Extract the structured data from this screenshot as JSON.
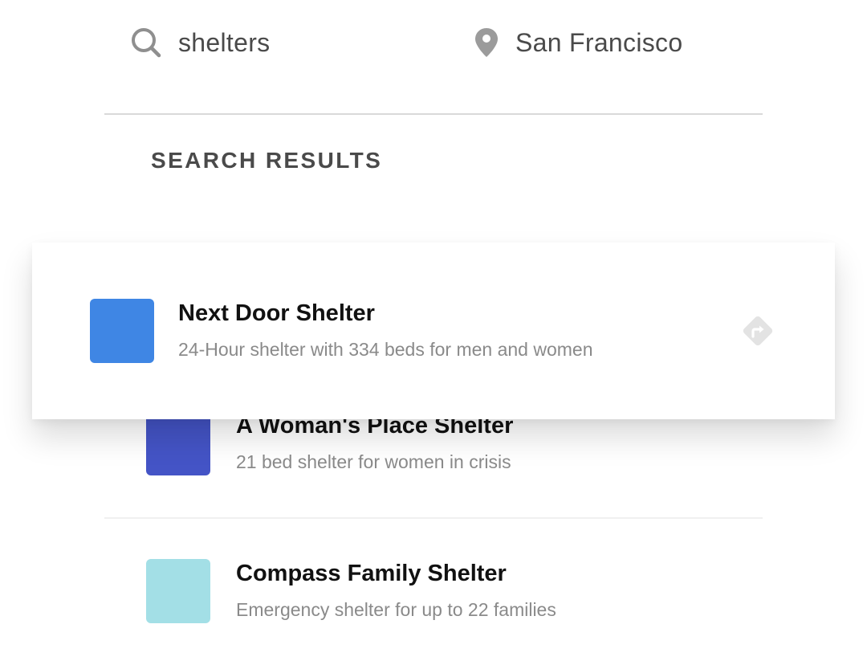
{
  "search": {
    "query": "shelters",
    "location": "San Francisco"
  },
  "results_heading": "SEARCH RESULTS",
  "results": [
    {
      "title": "Next Door Shelter",
      "description": "24-Hour shelter with 334 beds for men and women",
      "color": "#3f86e4",
      "directions_icon": "directions-icon"
    },
    {
      "title": "A Woman's Place Shelter",
      "description": "21 bed shelter for women in crisis",
      "color": "#4454c6"
    },
    {
      "title": "Compass Family Shelter",
      "description": "Emergency shelter for up to 22 families",
      "color": "#a3dfe6"
    }
  ],
  "colors": {
    "icon_gray": "#8f8f8f",
    "directions_gray": "#e3e3e3",
    "title": "#111111",
    "description": "#8a8a8a"
  }
}
